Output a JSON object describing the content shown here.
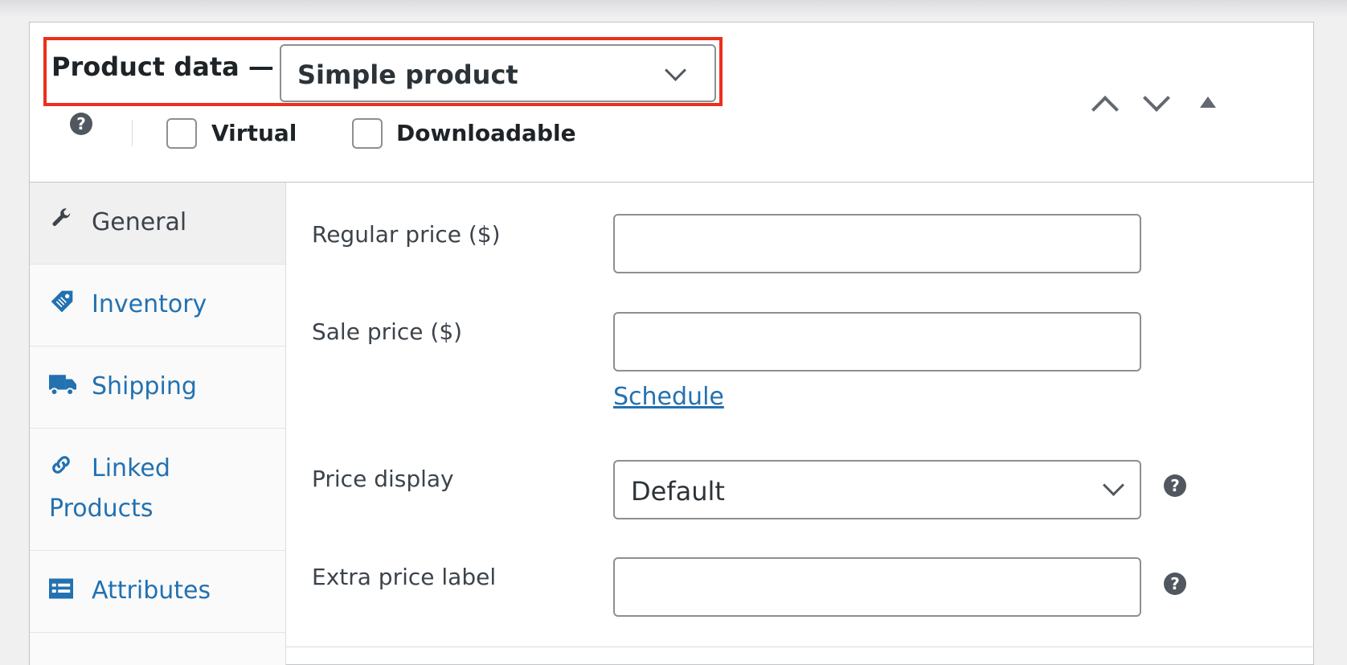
{
  "header": {
    "title": "Product data —",
    "product_type": "Simple product",
    "virtual_label": "Virtual",
    "downloadable_label": "Downloadable",
    "help_glyph": "?"
  },
  "colors": {
    "accent_link": "#2271b1",
    "highlight_border": "#ec2f1c",
    "active_tab_bg": "#f0f0f1"
  },
  "tabs": [
    {
      "label": "General",
      "icon": "wrench-icon",
      "active": true
    },
    {
      "label": "Inventory",
      "icon": "tag-icon",
      "active": false
    },
    {
      "label": "Shipping",
      "icon": "truck-icon",
      "active": false
    },
    {
      "label_line1": "Linked",
      "label_line2": "Products",
      "icon": "link-icon",
      "active": false
    },
    {
      "label": "Attributes",
      "icon": "list-icon",
      "active": false
    }
  ],
  "general": {
    "regular_price_label": "Regular price ($)",
    "regular_price_value": "",
    "sale_price_label": "Sale price ($)",
    "sale_price_value": "",
    "schedule_link": "Schedule",
    "price_display_label": "Price display",
    "price_display_value": "Default",
    "extra_price_label": "Extra price label",
    "extra_price_value": ""
  }
}
